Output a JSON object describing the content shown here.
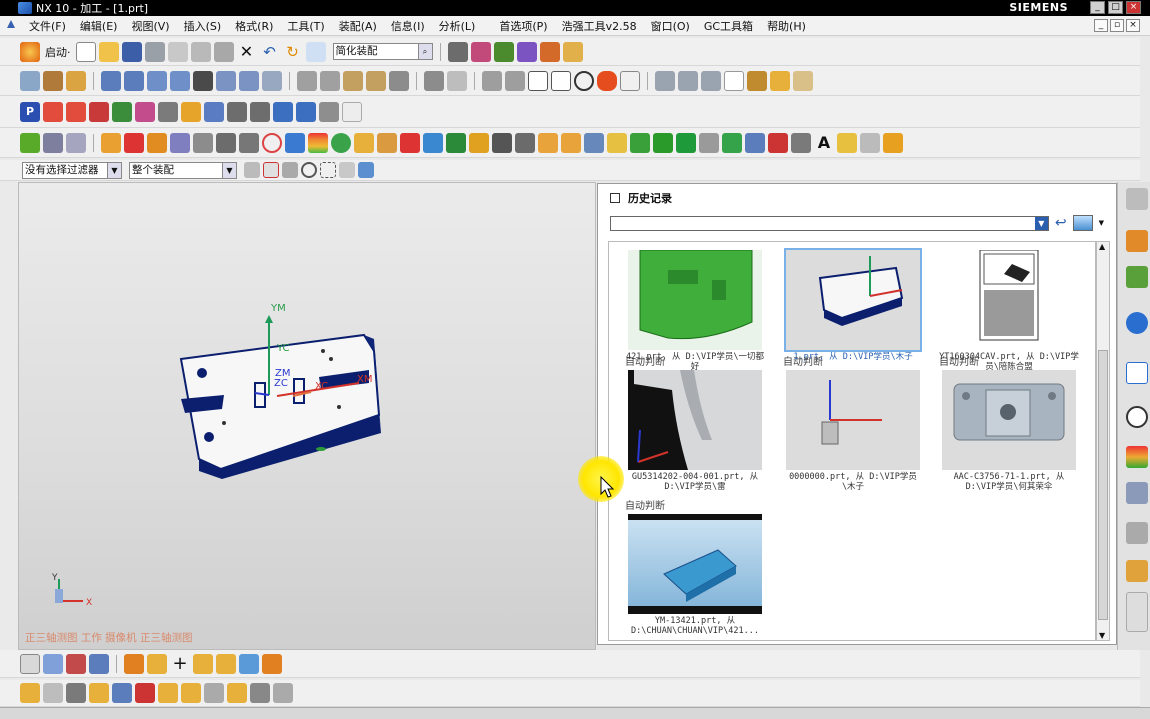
{
  "window": {
    "title": "NX 10 - 加工 - [1.prt]",
    "brand": "SIEMENS"
  },
  "menu": [
    "文件(F)",
    "编辑(E)",
    "视图(V)",
    "插入(S)",
    "格式(R)",
    "工具(T)",
    "装配(A)",
    "信息(I)",
    "分析(L)",
    "首选项(P)",
    "浩强工具v2.58",
    "窗口(O)",
    "GC工具箱",
    "帮助(H)"
  ],
  "toolbar1": {
    "start_label": "启动·",
    "assembly_combo": "简化装配"
  },
  "selection_bar": {
    "filter": "没有选择过滤器",
    "scope": "整个装配"
  },
  "viewport": {
    "axis_labels": {
      "ym": "YM",
      "yc": "YC",
      "xc": "XC",
      "zm": "ZM",
      "zc": "ZC",
      "xm": "XM"
    },
    "triad": {
      "y": "Y",
      "x": "X"
    },
    "view_label": "正三轴测图 工作 摄像机 正三轴测图"
  },
  "history": {
    "title": "历史记录",
    "items": [
      {
        "tag": "",
        "caption": "421.prt, 从 D:\\VIP学员\\一切都好",
        "selected": false
      },
      {
        "tag": "",
        "caption": "1.prt, 从 D:\\VIP学员\\木子",
        "selected": true
      },
      {
        "tag": "",
        "caption": "YT160304CAV.prt, 从 D:\\VIP学员\\陪陈合盟",
        "selected": false
      },
      {
        "tag": "自动判断",
        "caption": "GU5314202-004-001.prt, 从 D:\\VIP学员\\雷",
        "selected": false
      },
      {
        "tag": "自动判断",
        "caption": "0000000.prt, 从 D:\\VIP学员\\木子",
        "selected": false
      },
      {
        "tag": "自动判断",
        "caption": "AAC-C3756-71-1.prt, 从 D:\\VIP学员\\何其荣伞",
        "selected": false
      },
      {
        "tag": "自动判断",
        "caption": "YM-13421.prt, 从 D:\\CHUAN\\CHUAN\\VIP\\421...",
        "selected": false
      }
    ]
  },
  "colors": {
    "accent": "#2a5fb0",
    "cursor_halo": "#ffe600",
    "view_label": "#d98a6c"
  }
}
